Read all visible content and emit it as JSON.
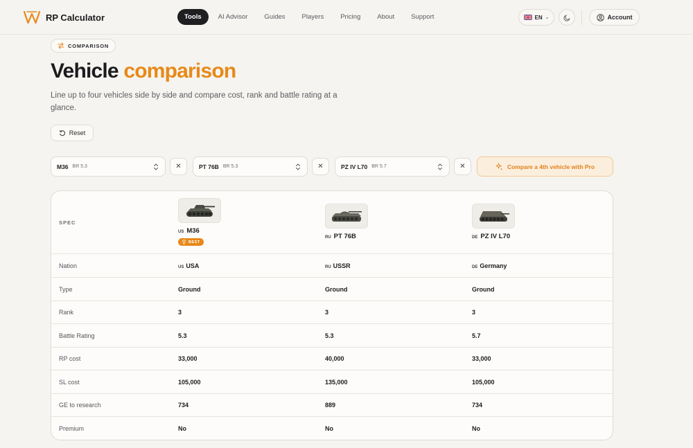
{
  "header": {
    "brand": "RP Calculator",
    "nav": [
      {
        "label": "Tools",
        "active": true
      },
      {
        "label": "AI Advisor",
        "active": false
      },
      {
        "label": "Guides",
        "active": false
      },
      {
        "label": "Players",
        "active": false
      },
      {
        "label": "Pricing",
        "active": false
      },
      {
        "label": "About",
        "active": false
      },
      {
        "label": "Support",
        "active": false
      }
    ],
    "language": "EN",
    "account_label": "Account"
  },
  "hero": {
    "badge": "COMPARISON",
    "title_part1": "Vehicle",
    "title_part2": "comparison",
    "subtitle": "Line up to four vehicles side by side and compare cost, rank and battle rating at a glance.",
    "reset_label": "Reset"
  },
  "selectors": [
    {
      "name": "M36",
      "br": "BR 5.3"
    },
    {
      "name": "PT 76B",
      "br": "BR 5.3"
    },
    {
      "name": "PZ IV L70",
      "br": "BR 5.7"
    }
  ],
  "pro_button_label": "Compare a 4th vehicle with Pro",
  "table": {
    "spec_header": "SPEC",
    "vehicles": [
      {
        "code": "US",
        "name": "M36",
        "badge": "BEST"
      },
      {
        "code": "RU",
        "name": "PT 76B"
      },
      {
        "code": "DE",
        "name": "PZ IV L70"
      }
    ],
    "rows": [
      {
        "label": "Nation",
        "values": [
          {
            "code": "US",
            "text": "USA"
          },
          {
            "code": "RU",
            "text": "USSR"
          },
          {
            "code": "DE",
            "text": "Germany"
          }
        ]
      },
      {
        "label": "Type",
        "values": [
          {
            "text": "Ground"
          },
          {
            "text": "Ground"
          },
          {
            "text": "Ground"
          }
        ]
      },
      {
        "label": "Rank",
        "values": [
          {
            "text": "3"
          },
          {
            "text": "3"
          },
          {
            "text": "3"
          }
        ]
      },
      {
        "label": "Battle Rating",
        "values": [
          {
            "text": "5.3"
          },
          {
            "text": "5.3"
          },
          {
            "text": "5.7"
          }
        ]
      },
      {
        "label": "RP cost",
        "values": [
          {
            "text": "33,000"
          },
          {
            "text": "40,000"
          },
          {
            "text": "33,000"
          }
        ]
      },
      {
        "label": "SL cost",
        "values": [
          {
            "text": "105,000"
          },
          {
            "text": "135,000"
          },
          {
            "text": "105,000"
          }
        ]
      },
      {
        "label": "GE to research",
        "values": [
          {
            "text": "734"
          },
          {
            "text": "889"
          },
          {
            "text": "734"
          }
        ]
      },
      {
        "label": "Premium",
        "values": [
          {
            "text": "No"
          },
          {
            "text": "No"
          },
          {
            "text": "No"
          }
        ]
      }
    ]
  },
  "colors": {
    "accent": "#e8891a",
    "background": "#f5f4f0",
    "nav_active": "#1f1f22",
    "pro_bg": "#fbeedd"
  }
}
